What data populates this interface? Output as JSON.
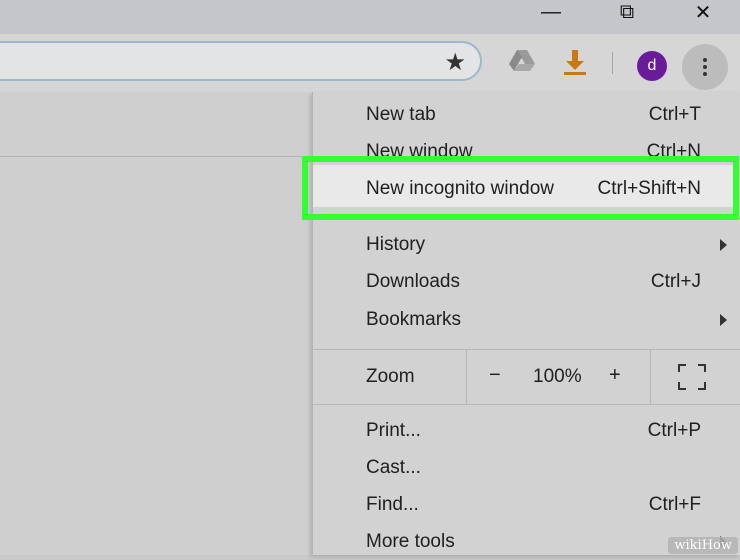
{
  "window_controls": {
    "minimize": "—",
    "restore": "⧉",
    "close": "✕"
  },
  "toolbar": {
    "star_icon": "★",
    "avatar_letter": "d",
    "icons": [
      "google-drive-icon",
      "download-icon",
      "more-icon"
    ]
  },
  "menu": {
    "items": [
      {
        "label": "New tab",
        "shortcut": "Ctrl+T"
      },
      {
        "label": "New window",
        "shortcut": "Ctrl+N"
      },
      {
        "label": "New incognito window",
        "shortcut": "Ctrl+Shift+N"
      },
      {
        "label": "History",
        "shortcut": ""
      },
      {
        "label": "Downloads",
        "shortcut": "Ctrl+J"
      },
      {
        "label": "Bookmarks",
        "shortcut": ""
      },
      {
        "label": "Print...",
        "shortcut": "Ctrl+P"
      },
      {
        "label": "Cast...",
        "shortcut": ""
      },
      {
        "label": "Find...",
        "shortcut": "Ctrl+F"
      },
      {
        "label": "More tools",
        "shortcut": ""
      }
    ],
    "zoom": {
      "label": "Zoom",
      "minus": "−",
      "value": "100%",
      "plus": "+"
    }
  },
  "watermark": "wikiHow",
  "colors": {
    "highlight_border": "#33ff33",
    "avatar": "#6a1b9a",
    "download_arrow": "#c77a12"
  }
}
